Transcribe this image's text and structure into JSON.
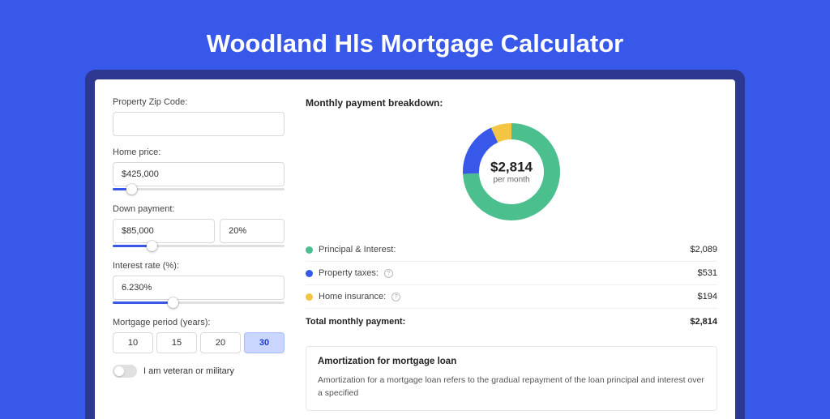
{
  "title": "Woodland Hls Mortgage Calculator",
  "form": {
    "zip_label": "Property Zip Code:",
    "zip_value": "",
    "price_label": "Home price:",
    "price_value": "$425,000",
    "down_label": "Down payment:",
    "down_value": "$85,000",
    "down_pct": "20%",
    "rate_label": "Interest rate (%):",
    "rate_value": "6.230%",
    "period_label": "Mortgage period (years):",
    "periods": [
      "10",
      "15",
      "20",
      "30"
    ],
    "period_active": "30",
    "veteran_label": "I am veteran or military"
  },
  "breakdown": {
    "heading": "Monthly payment breakdown:",
    "center_amount": "$2,814",
    "center_sub": "per month",
    "items": [
      {
        "label": "Principal & Interest:",
        "value": "$2,089",
        "color": "green",
        "info": false
      },
      {
        "label": "Property taxes:",
        "value": "$531",
        "color": "blue",
        "info": true
      },
      {
        "label": "Home insurance:",
        "value": "$194",
        "color": "yellow",
        "info": true
      }
    ],
    "total_label": "Total monthly payment:",
    "total_value": "$2,814"
  },
  "amortization": {
    "title": "Amortization for mortgage loan",
    "body": "Amortization for a mortgage loan refers to the gradual repayment of the loan principal and interest over a specified"
  },
  "chart_data": {
    "type": "pie",
    "title": "Monthly payment breakdown",
    "series": [
      {
        "name": "Principal & Interest",
        "value": 2089,
        "color": "#4bbf8e"
      },
      {
        "name": "Property taxes",
        "value": 531,
        "color": "#3858e9"
      },
      {
        "name": "Home insurance",
        "value": 194,
        "color": "#f4c542"
      }
    ],
    "total": 2814
  },
  "colors": {
    "bg": "#3858e9",
    "green": "#4bbf8e",
    "blue": "#3858e9",
    "yellow": "#f4c542"
  }
}
